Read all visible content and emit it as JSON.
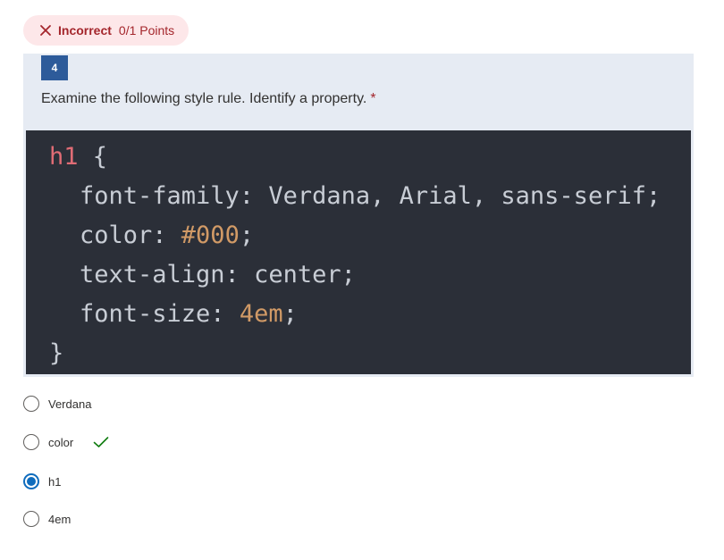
{
  "result": {
    "status": "Incorrect",
    "points": "0/1 Points",
    "icon": "close-icon",
    "color": "#a4262c",
    "background": "#fde7e9"
  },
  "question": {
    "number": "4",
    "text": "Examine the following style rule. Identify a property.",
    "required_marker": "*"
  },
  "code": {
    "lines": [
      [
        {
          "t": "h1",
          "c": "sel"
        },
        {
          "t": " {",
          "c": ""
        }
      ],
      [
        {
          "t": "font-family: Verdana, Arial, sans-serif;",
          "c": ""
        }
      ],
      [
        {
          "t": "color: ",
          "c": ""
        },
        {
          "t": "#000",
          "c": "num"
        },
        {
          "t": ";",
          "c": ""
        }
      ],
      [
        {
          "t": "text-align: center;",
          "c": ""
        }
      ],
      [
        {
          "t": "font-size: ",
          "c": ""
        },
        {
          "t": "4em",
          "c": "num"
        },
        {
          "t": ";",
          "c": ""
        }
      ],
      [
        {
          "t": "}",
          "c": ""
        }
      ]
    ]
  },
  "options": [
    {
      "label": "Verdana",
      "selected": false,
      "correct": false
    },
    {
      "label": "color",
      "selected": false,
      "correct": true
    },
    {
      "label": "h1",
      "selected": true,
      "correct": false
    },
    {
      "label": "4em",
      "selected": false,
      "correct": false
    }
  ],
  "colors": {
    "accent": "#0f6cbd",
    "question_number_bg": "#2d5b9a",
    "card_bg": "#e6ebf3",
    "code_bg": "#2b2f38",
    "correct_check": "#107c10"
  }
}
